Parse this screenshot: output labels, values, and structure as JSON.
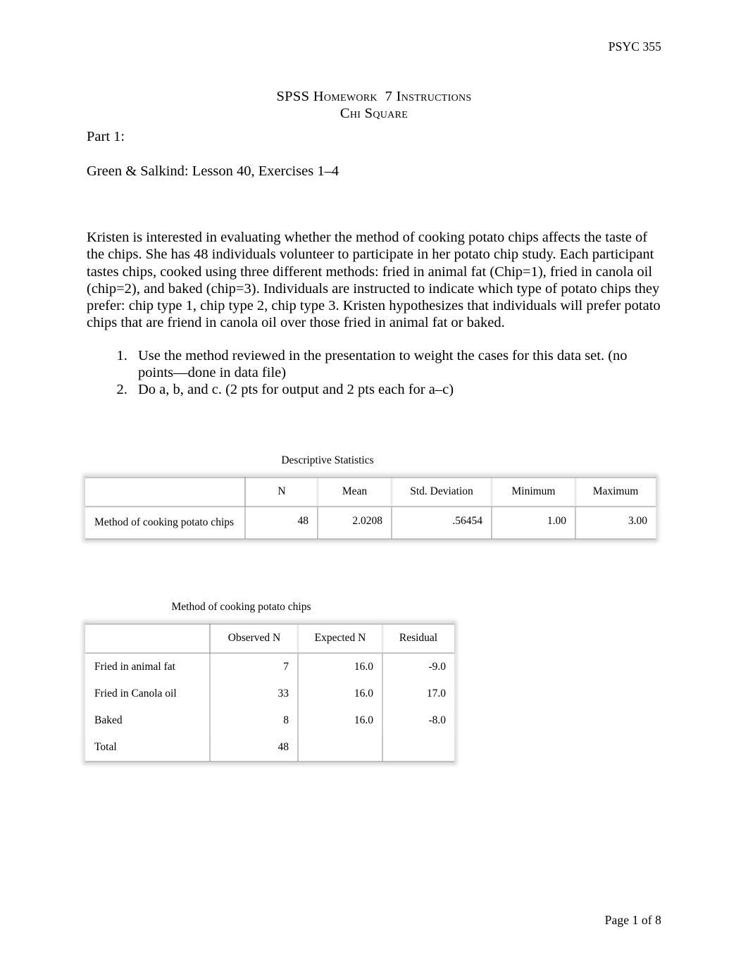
{
  "header": {
    "course_code": "PSYC 355"
  },
  "footer": {
    "page_label": "Page 1 of 8"
  },
  "title": {
    "main": "SPSS Homework  7 Instructions",
    "subtitle": "Chi Square"
  },
  "body": {
    "part_label": "Part 1:",
    "reference": "Green & Salkind: Lesson 40, Exercises 1–4",
    "scenario": "Kristen is interested in evaluating whether the method of cooking potato chips affects the taste of the chips. She has 48 individuals volunteer to participate in her potato chip study. Each participant tastes chips, cooked using three different methods: fried in animal fat (Chip=1), fried in canola oil (chip=2), and baked (chip=3). Individuals are instructed to indicate which type of potato chips they prefer: chip type 1, chip type 2, chip type 3. Kristen hypothesizes that individuals will prefer potato chips that are friend in canola oil over those fried in animal fat or baked.",
    "tasks": [
      "Use the method reviewed in the presentation to weight the cases for this data set. (no points—done in data file)",
      "Do a, b, and c. (2 pts for output and 2 pts each for a–c)"
    ]
  },
  "descriptive_statistics_table": {
    "caption": "Descriptive Statistics",
    "corner_header": "",
    "columns": [
      "N",
      "Mean",
      "Std. Deviation",
      "Minimum",
      "Maximum"
    ],
    "rows": [
      {
        "label": "Method of cooking potato chips",
        "values": [
          "48",
          "2.0208",
          ".56454",
          "1.00",
          "3.00"
        ]
      }
    ]
  },
  "chi_square_frequencies_table": {
    "caption": "Method of cooking potato chips",
    "corner_header": "",
    "columns": [
      "Observed N",
      "Expected N",
      "Residual"
    ],
    "rows": [
      {
        "label": "Fried in animal fat",
        "values": [
          "7",
          "16.0",
          "-9.0"
        ]
      },
      {
        "label": "Fried in Canola oil",
        "values": [
          "33",
          "16.0",
          "17.0"
        ]
      },
      {
        "label": "Baked",
        "values": [
          "8",
          "16.0",
          "-8.0"
        ]
      },
      {
        "label": "Total",
        "values": [
          "48",
          "",
          ""
        ]
      }
    ]
  }
}
